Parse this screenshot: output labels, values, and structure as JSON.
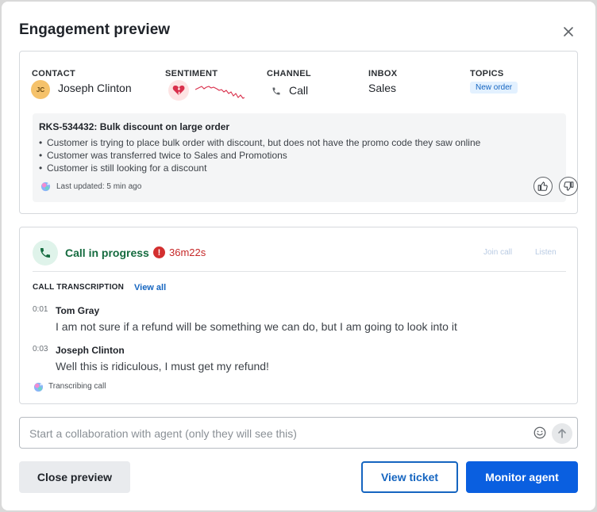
{
  "title": "Engagement preview",
  "contact": {
    "label": "CONTACT",
    "initials": "JC",
    "name": "Joseph Clinton"
  },
  "sentiment": {
    "label": "SENTIMENT"
  },
  "channel": {
    "label": "CHANNEL",
    "value": "Call"
  },
  "inbox": {
    "label": "INBOX",
    "value": "Sales"
  },
  "topics": {
    "label": "TOPICS",
    "items": [
      "New order"
    ]
  },
  "summary": {
    "title": "RKS-534432: Bulk discount on large order",
    "bullets": [
      "Customer is trying to place bulk order with discount, but does not have the promo code they saw online",
      "Customer was transferred twice to Sales and Promotions",
      "Customer is still looking for a discount"
    ],
    "updated": "Last updated: 5 min ago"
  },
  "call": {
    "status": "Call in progress",
    "duration": "36m22s",
    "join_label": "Join call",
    "listen_label": "Listen"
  },
  "transcription": {
    "label": "CALL TRANSCRIPTION",
    "view_all": "View all",
    "entries": [
      {
        "time": "0:01",
        "speaker": "Tom Gray",
        "text": "I am not sure if a refund will be something we can do, but I am going to look into it"
      },
      {
        "time": "0:03",
        "speaker": "Joseph Clinton",
        "text": "Well this is ridiculous, I must get my refund!"
      }
    ],
    "status": "Transcribing call"
  },
  "composer": {
    "placeholder": "Start a collaboration with agent (only they will see this)"
  },
  "buttons": {
    "close": "Close preview",
    "view_ticket": "View ticket",
    "monitor": "Monitor agent"
  },
  "colors": {
    "primary": "#0a5fe0",
    "call_green": "#156b3f",
    "alert_red": "#d32f2f",
    "topic_bg": "#e3f1ff"
  }
}
